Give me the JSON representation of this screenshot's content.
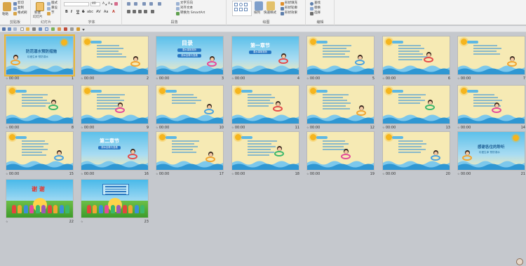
{
  "ribbon": {
    "clipboard": {
      "paste": "粘贴",
      "cut": "剪切",
      "copy": "复制",
      "format_painter": "格式刷",
      "group": "剪贴板"
    },
    "slides": {
      "new_slide": "新建",
      "new_slide2": "幻灯片",
      "layout": "版式",
      "reset": "重设",
      "section": "节",
      "group": "幻灯片"
    },
    "font": {
      "size": "40",
      "bold": "B",
      "italic": "I",
      "underline": "U",
      "strike": "S",
      "shadow": "abc",
      "spacing": "AV",
      "case": "Aa",
      "color": "A",
      "group": "字体"
    },
    "paragraph": {
      "text_direction": "文字方向",
      "align_text": "对齐文本",
      "smartart": "转换为 SmartArt",
      "group": "段落"
    },
    "drawing": {
      "arrange": "排列",
      "quick_styles": "快速样式",
      "shape_fill": "形状填充",
      "shape_outline": "形状轮廓",
      "shape_effects": "形状效果",
      "group": "绘图"
    },
    "editing": {
      "find": "查找",
      "replace": "替换",
      "select": "选择",
      "group": "编辑"
    }
  },
  "slides": [
    {
      "num": "1",
      "time": "00:00",
      "kind": "cover",
      "title": "防范溺水预防措施",
      "subtitle": "珍爱生命 预防溺水"
    },
    {
      "num": "2",
      "time": "00:00",
      "kind": "content"
    },
    {
      "num": "3",
      "time": "00:00",
      "kind": "toc",
      "title": "目录",
      "item1": "溺水事故现状",
      "item2": "溺水自救与急救"
    },
    {
      "num": "4",
      "time": "00:00",
      "kind": "section",
      "title": "第一章节",
      "item1": "溺水事故现状"
    },
    {
      "num": "5",
      "time": "00:00",
      "kind": "content"
    },
    {
      "num": "6",
      "time": "00:00",
      "kind": "content"
    },
    {
      "num": "7",
      "time": "00:00",
      "kind": "content"
    },
    {
      "num": "8",
      "time": "00:00",
      "kind": "content"
    },
    {
      "num": "9",
      "time": "00:00",
      "kind": "content"
    },
    {
      "num": "10",
      "time": "00:00",
      "kind": "content"
    },
    {
      "num": "11",
      "time": "00:00",
      "kind": "content"
    },
    {
      "num": "12",
      "time": "00:00",
      "kind": "content"
    },
    {
      "num": "13",
      "time": "00:00",
      "kind": "content"
    },
    {
      "num": "14",
      "time": "00:00",
      "kind": "content"
    },
    {
      "num": "15",
      "time": "00:00",
      "kind": "content"
    },
    {
      "num": "16",
      "time": "00:00",
      "kind": "section",
      "title": "第二章节",
      "item1": "溺水自救与急救"
    },
    {
      "num": "17",
      "time": "00:00",
      "kind": "content"
    },
    {
      "num": "18",
      "time": "00:00",
      "kind": "content"
    },
    {
      "num": "19",
      "time": "00:00",
      "kind": "content"
    },
    {
      "num": "20",
      "time": "00:00",
      "kind": "content"
    },
    {
      "num": "21",
      "time": "00:00",
      "kind": "cover",
      "title": "感谢各位的聆听",
      "subtitle": "珍爱生命 预防溺水"
    },
    {
      "num": "22",
      "time": "",
      "kind": "thanks",
      "title": "谢 谢"
    },
    {
      "num": "23",
      "time": "",
      "kind": "thanks-info"
    }
  ],
  "colors": {
    "accent": "#e8b93a",
    "sky": "#5db8e4",
    "paper": "#f6eab4",
    "water": "#3aa6dc"
  }
}
